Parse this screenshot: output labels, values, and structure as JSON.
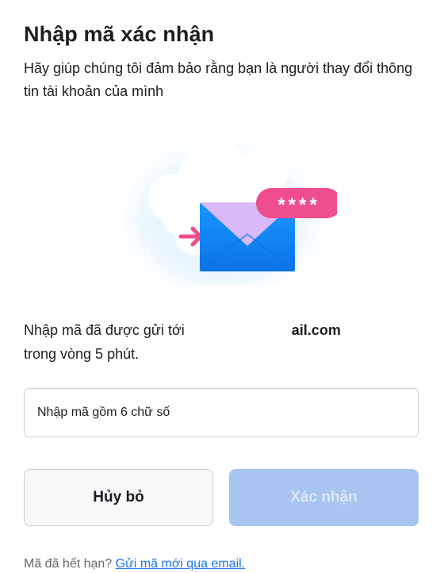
{
  "header": {
    "title": "Nhập mã xác nhận",
    "subtitle": "Hãy giúp chúng tôi đảm bảo rằng bạn là người thay đổi thông tin tài khoản của mình"
  },
  "illustration": {
    "code_mask": "****",
    "icon": "envelope-icon",
    "colors": {
      "envelope": "#1877f2",
      "flap": "#d9b9f7",
      "badge": "#f04d8f",
      "arrow": "#f04d8f",
      "cloud": "#ffffff"
    }
  },
  "message": {
    "prefix": "Nhập mã đã được gửi tới ",
    "email_visible": "ail.com",
    "suffix": "trong vòng 5 phút."
  },
  "code_input": {
    "placeholder": "Nhập mã gồm 6 chữ số",
    "value": ""
  },
  "actions": {
    "cancel_label": "Hủy bỏ",
    "confirm_label": "Xác nhận"
  },
  "footer": {
    "text": "Mã đã hết hạn?",
    "link": "Gửi mã mới qua email."
  },
  "colors": {
    "primary": "#1877f2",
    "primary_disabled": "#a7c5f0",
    "text": "#1c1e21",
    "muted": "#65676b"
  }
}
